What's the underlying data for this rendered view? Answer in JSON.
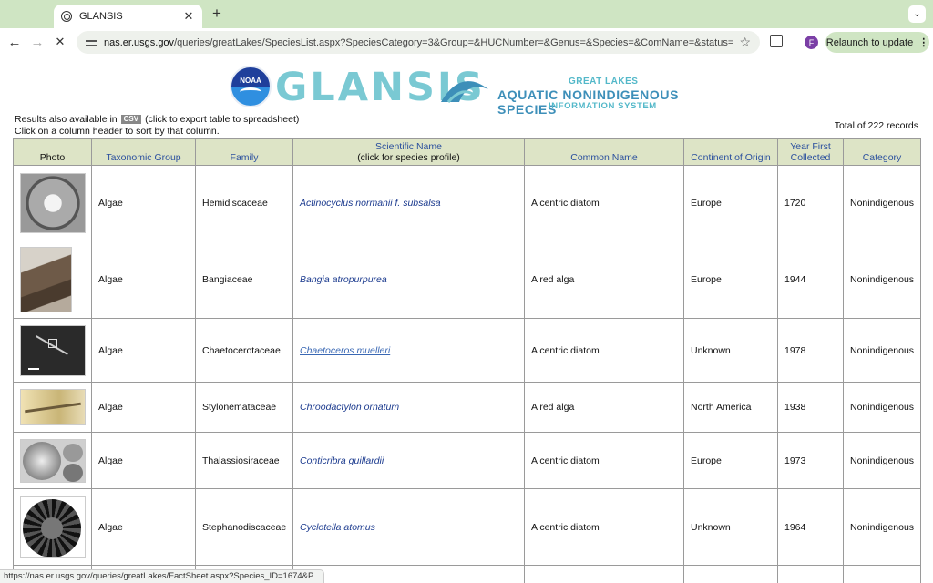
{
  "browser": {
    "tab_title": "GLANSIS",
    "url_host": "nas.er.usgs.gov",
    "url_rest": "/queries/greatLakes/SpeciesList.aspx?SpeciesCategory=3&Group=&HUCNumber=&Genus=&Species=&ComName=&status=0&p...",
    "relaunch_label": "Relaunch to update",
    "avatar_letter": "F",
    "status_url": "https://nas.er.usgs.gov/queries/greatLakes/FactSheet.aspx?Species_ID=1674&P..."
  },
  "banner": {
    "noaa_label": "NOAA",
    "logo_word": "GLANSIS",
    "line1": "GREAT LAKES",
    "line2": "AQUATIC NONINDIGENOUS SPECIES",
    "line3": "INFORMATION SYSTEM"
  },
  "info": {
    "results_prefix": "Results also available in",
    "csv_label": "CSV",
    "results_suffix": "(click to export table to spreadsheet)",
    "sort_hint": "Click on a column header to sort by that column.",
    "total": "Total of 222 records"
  },
  "table": {
    "headers": {
      "photo": "Photo",
      "group": "Taxonomic Group",
      "family": "Family",
      "sci_line1": "Scientific Name",
      "sci_line2": "(click for species profile)",
      "common": "Common Name",
      "continent": "Continent of Origin",
      "year_line1": "Year First",
      "year_line2": "Collected",
      "category": "Category"
    },
    "rows": [
      {
        "group": "Algae",
        "family": "Hemidiscaceae",
        "scientific": "Actinocyclus normanii f. subsalsa",
        "common": "A centric diatom",
        "continent": "Europe",
        "year": "1720",
        "category": "Nonindigenous"
      },
      {
        "group": "Algae",
        "family": "Bangiaceae",
        "scientific": "Bangia atropurpurea",
        "common": "A red alga",
        "continent": "Europe",
        "year": "1944",
        "category": "Nonindigenous"
      },
      {
        "group": "Algae",
        "family": "Chaetocerotaceae",
        "scientific": "Chaetoceros muelleri",
        "common": "A centric diatom",
        "continent": "Unknown",
        "year": "1978",
        "category": "Nonindigenous"
      },
      {
        "group": "Algae",
        "family": "Stylonemataceae",
        "scientific": "Chroodactylon ornatum",
        "common": "A red alga",
        "continent": "North America",
        "year": "1938",
        "category": "Nonindigenous"
      },
      {
        "group": "Algae",
        "family": "Thalassiosiraceae",
        "scientific": "Conticribra guillardii",
        "common": "A centric diatom",
        "continent": "Europe",
        "year": "1973",
        "category": "Nonindigenous"
      },
      {
        "group": "Algae",
        "family": "Stephanodiscaceae",
        "scientific": "Cyclotella atomus",
        "common": "A centric diatom",
        "continent": "Unknown",
        "year": "1964",
        "category": "Nonindigenous"
      }
    ]
  }
}
